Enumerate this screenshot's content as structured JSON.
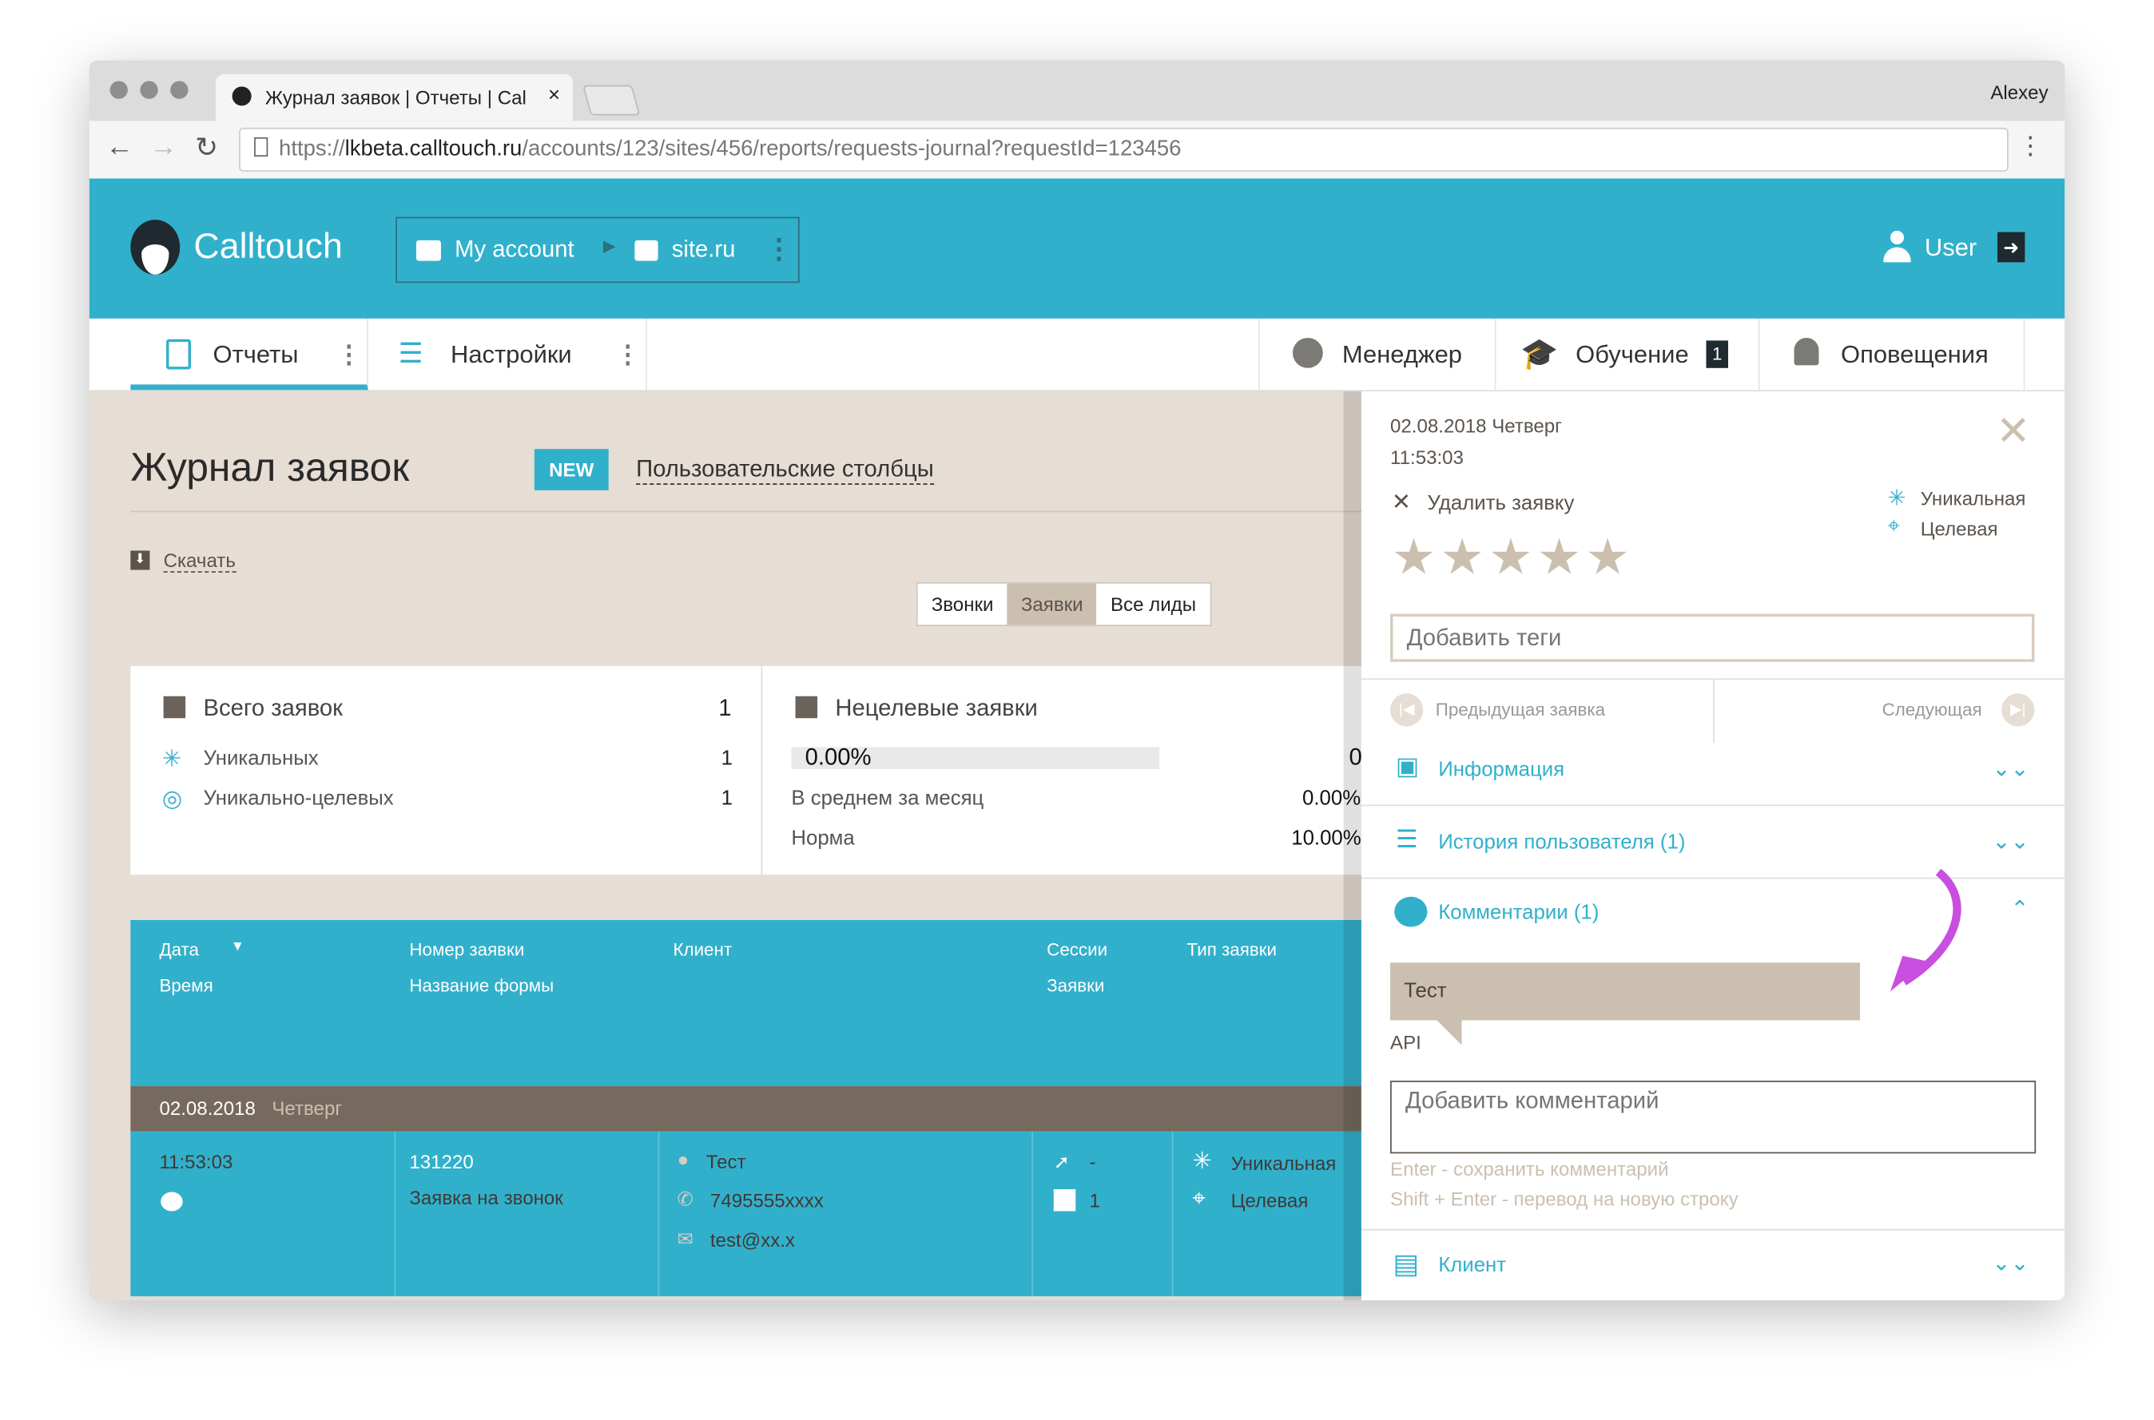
{
  "browser": {
    "tab_title": "Журнал заявок | Отчеты | Cal",
    "url_prefix": "https://",
    "url_host": "lkbeta.calltouch.ru",
    "url_path": "/accounts/123/sites/456/reports/requests-journal?requestId=123456",
    "profile": "Alexey"
  },
  "header": {
    "logo": "Calltouch",
    "account": "My account",
    "site": "site.ru",
    "user": "User"
  },
  "nav": {
    "reports": "Отчеты",
    "settings": "Настройки",
    "manager": "Менеджер",
    "learning": "Обучение",
    "learning_badge": "1",
    "notifications": "Оповещения"
  },
  "page": {
    "title": "Журнал заявок",
    "new_badge": "NEW",
    "custom_columns": "Пользовательские столбцы",
    "download": "Скачать",
    "segments": [
      "Звонки",
      "Заявки",
      "Все лиды"
    ],
    "active_segment": "Заявки"
  },
  "stats": {
    "total_label": "Всего заявок",
    "total": "1",
    "unique_label": "Уникальных",
    "unique": "1",
    "unique_target_label": "Уникально-целевых",
    "unique_target": "1",
    "nontarget_label": "Нецелевые заявки",
    "nontarget_percent": "0.00%",
    "nontarget_percent_value": 0,
    "nontarget_count": "0",
    "monthly_avg_label": "В среднем за месяц",
    "monthly_avg": "0.00%",
    "norm_label": "Норма",
    "norm": "10.00%"
  },
  "table": {
    "headers": {
      "date": "Дата",
      "time": "Время",
      "number": "Номер заявки",
      "form": "Название формы",
      "client": "Клиент",
      "sessions": "Сессии",
      "requests": "Заявки",
      "type": "Тип заявки"
    },
    "group": {
      "date": "02.08.2018",
      "weekday": "Четверг"
    },
    "row": {
      "time": "11:53:03",
      "number": "131220",
      "form": "Заявка на звонок",
      "client_name": "Тест",
      "phone": "7495555xxxx",
      "email": "test@xx.x",
      "sessions": "-",
      "requests": "1",
      "type_unique": "Уникальная",
      "type_target": "Целевая"
    }
  },
  "panel": {
    "date": "02.08.2018 Четверг",
    "time": "11:53:03",
    "delete": "Удалить заявку",
    "unique": "Уникальная",
    "target": "Целевая",
    "rating": 0,
    "tags_placeholder": "Добавить теги",
    "prev": "Предыдущая заявка",
    "next": "Следующая",
    "info": "Информация",
    "history": "История пользователя (1)",
    "comments": "Комментарии (1)",
    "comment_text": "Тест",
    "comment_author": "API",
    "comment_placeholder": "Добавить комментарий",
    "hint1": "Enter - сохранить комментарий",
    "hint2": "Shift + Enter - перевод на новую строку",
    "client": "Клиент"
  },
  "colors": {
    "brand": "#31b0cc",
    "beige": "#e6ddd4",
    "group_row": "#756a5d",
    "annotation_arrow": "#c84fe0"
  }
}
